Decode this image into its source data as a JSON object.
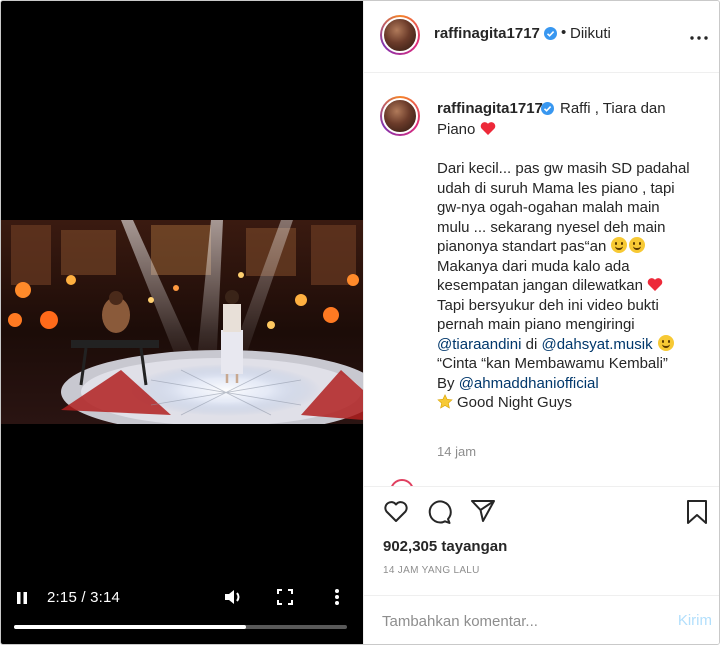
{
  "post_header": {
    "username": "raffinagita1717",
    "separator": "•",
    "follow_status": "Diikuti"
  },
  "caption": {
    "username": "raffinagita1717",
    "title_line1": "Raffi , Tiara dan",
    "title_line2": "Piano",
    "lines": [
      "Dari kecil... pas gw masih SD padahal",
      "udah di suruh Mama les piano , tapi",
      "gw-nya ogah-ogahan malah main",
      "mulu ... sekarang nyesel deh main",
      "pianonya standart pas“an",
      "Makanya dari muda kalo ada",
      "kesempatan jangan dilewatkan",
      "Tapi bersyukur deh ini video bukti",
      "pernah main piano mengiringi",
      "@tiaraandini",
      "di",
      "@dahsyat.musik",
      "“Cinta “kan Membawamu Kembali”",
      "By",
      "@ahmaddhaniofficial",
      "Good Night Guys"
    ],
    "time": "14 jam"
  },
  "actions": {
    "like": "like-icon",
    "comment": "comment-icon",
    "share": "share-icon",
    "save": "bookmark-icon",
    "views": "902,305 tayangan",
    "post_age": "14 JAM YANG LALU"
  },
  "comment_bar": {
    "placeholder": "Tambahkan komentar...",
    "post_label": "Kirim"
  },
  "video": {
    "time": "2:15 / 3:14",
    "progress": 0.6959
  },
  "colors": {
    "mention": "#00376b",
    "post_disabled": "#b2dffc",
    "heart": "#ed2939"
  }
}
